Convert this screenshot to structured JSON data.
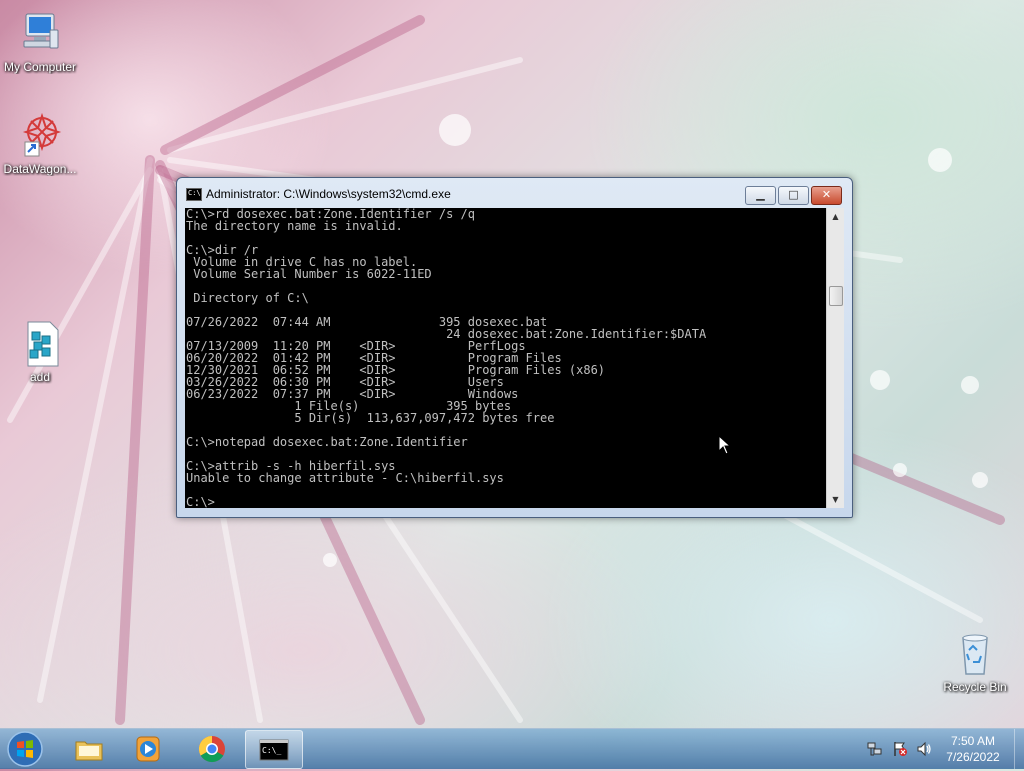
{
  "desktop": {
    "icons": [
      {
        "label": "My Computer"
      },
      {
        "label": "DataWagon..."
      },
      {
        "label": "add"
      },
      {
        "label": "Recycle Bin"
      }
    ]
  },
  "window": {
    "title": "Administrator: C:\\Windows\\system32\\cmd.exe",
    "icon_text": "C:\\",
    "buttons": {
      "minimize": "▁",
      "maximize": "□",
      "close": "✕"
    },
    "console_lines": [
      "C:\\>rd dosexec.bat:Zone.Identifier /s /q",
      "The directory name is invalid.",
      "",
      "C:\\>dir /r",
      " Volume in drive C has no label.",
      " Volume Serial Number is 6022-11ED",
      "",
      " Directory of C:\\",
      "",
      "07/26/2022  07:44 AM               395 dosexec.bat",
      "                                    24 dosexec.bat:Zone.Identifier:$DATA",
      "07/13/2009  11:20 PM    <DIR>          PerfLogs",
      "06/20/2022  01:42 PM    <DIR>          Program Files",
      "12/30/2021  06:52 PM    <DIR>          Program Files (x86)",
      "03/26/2022  06:30 PM    <DIR>          Users",
      "06/23/2022  07:37 PM    <DIR>          Windows",
      "               1 File(s)            395 bytes",
      "               5 Dir(s)  113,637,097,472 bytes free",
      "",
      "C:\\>notepad dosexec.bat:Zone.Identifier",
      "",
      "C:\\>attrib -s -h hiberfil.sys",
      "Unable to change attribute - C:\\hiberfil.sys",
      "",
      "C:\\>"
    ]
  },
  "taskbar": {
    "cmd_icon_text": "C:\\_",
    "clock": {
      "time": "7:50 AM",
      "date": "7/26/2022"
    }
  }
}
